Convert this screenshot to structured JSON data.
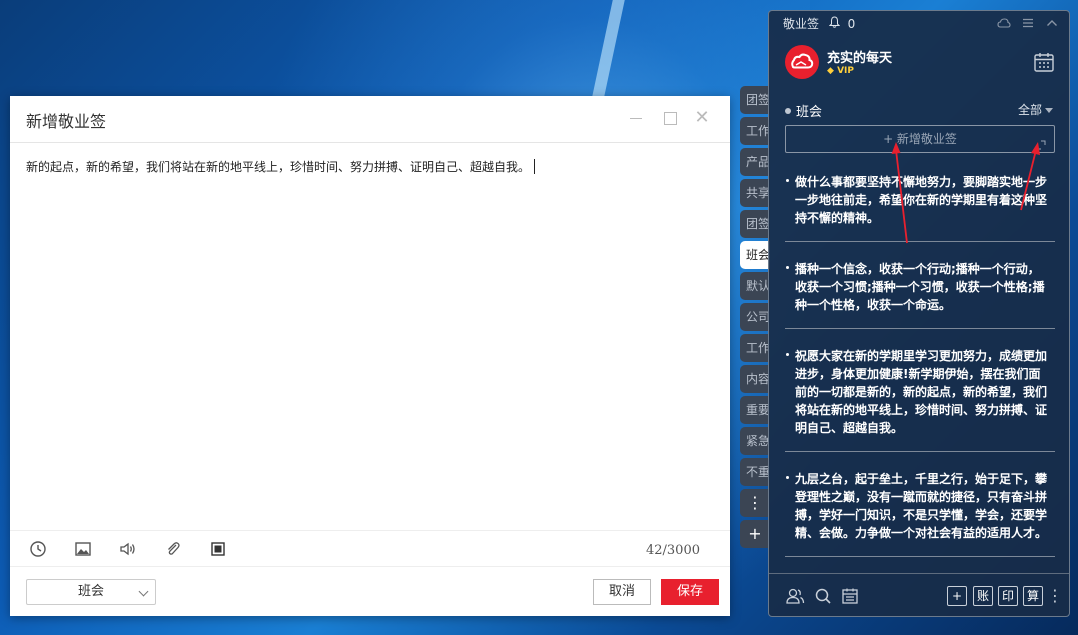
{
  "editor": {
    "title": "新增敬业签",
    "content": "新的起点，新的希望，我们将站在新的地平线上，珍惜时间、努力拼搏、证明自己、超越自我。",
    "char_count": "42/3000",
    "category": "班会",
    "cancel_label": "取消",
    "save_label": "保存"
  },
  "tabs": [
    {
      "label": "团签"
    },
    {
      "label": "工作"
    },
    {
      "label": "产品"
    },
    {
      "label": "共享"
    },
    {
      "label": "团签"
    },
    {
      "label": "班会"
    },
    {
      "label": "默认"
    },
    {
      "label": "公司"
    },
    {
      "label": "工作"
    },
    {
      "label": "内容"
    },
    {
      "label": "重要"
    },
    {
      "label": "紧急"
    },
    {
      "label": "不重"
    }
  ],
  "panel": {
    "app_name": "敬业签",
    "bell_count": "0",
    "username": "充实的每天",
    "vip": "VIP",
    "section": "班会",
    "filter": "全部",
    "add_placeholder": "+ 新增敬业签",
    "notes": [
      {
        "text": "做什么事都要坚持不懈地努力，要脚踏实地一步一步地往前走，希望你在新的学期里有着这种坚持不懈的精神。"
      },
      {
        "text": "播种一个信念，收获一个行动;播种一个行动，收获一个习惯;播种一个习惯，收获一个性格;播种一个性格，收获一个命运。"
      },
      {
        "text": "祝愿大家在新的学期里学习更加努力，成绩更加进步，身体更加健康!新学期伊始，摆在我们面前的一切都是新的，新的起点，新的希望，我们将站在新的地平线上，珍惜时间、努力拼搏、证明自己、超越自我。"
      },
      {
        "text": "九层之台，起于垒土，千里之行，始于足下，攀登理性之巅，没有一蹴而就的捷径，只有奋斗拼搏，学好一门知识，不是只学懂，学会，还要学精、会做。力争做一个对社会有益的适用人才。"
      }
    ],
    "bottom": {
      "add": "+",
      "ledger": "账",
      "print": "印",
      "calc": "算"
    }
  },
  "colors": {
    "accent": "#e8202e",
    "panel_bg": "#182c48",
    "tab_bg": "#3b4554"
  }
}
